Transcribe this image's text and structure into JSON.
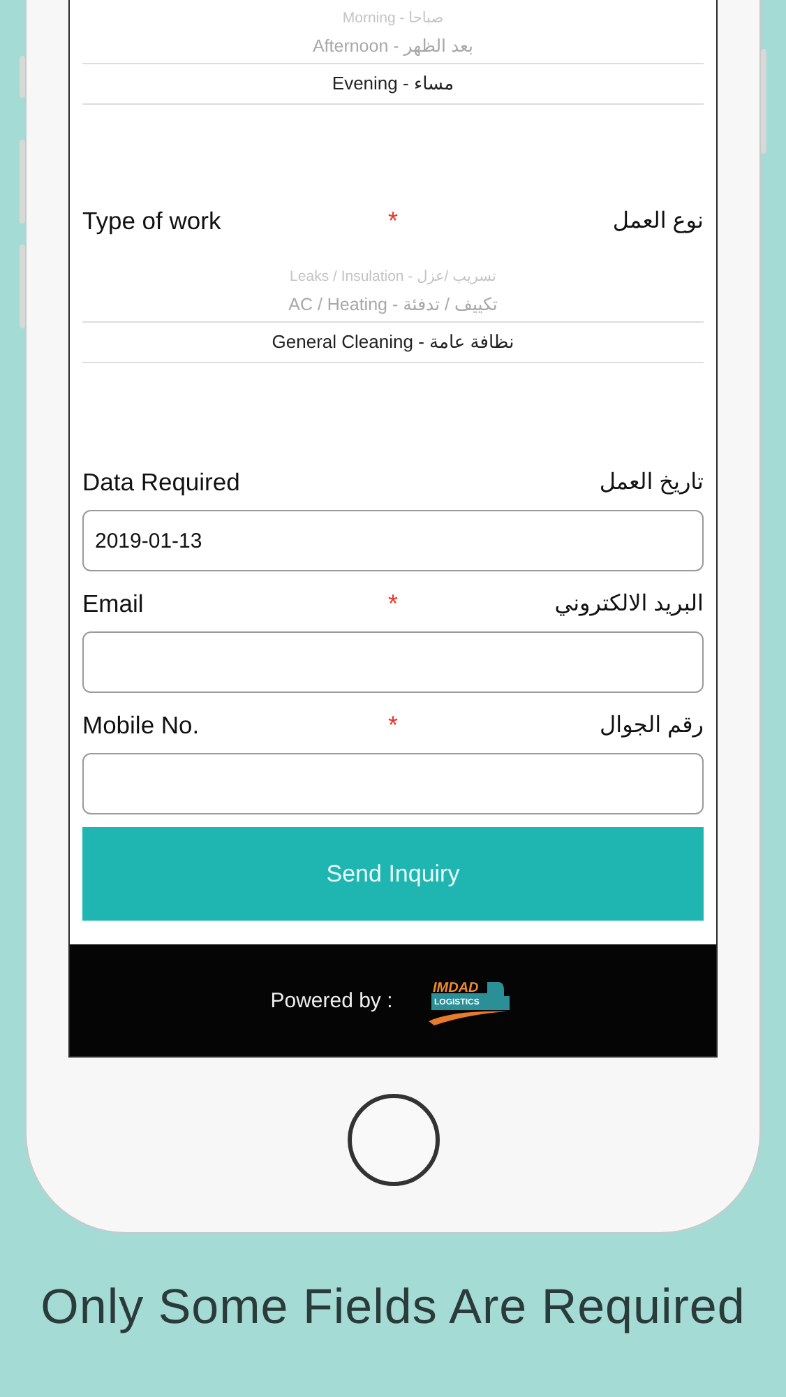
{
  "time_picker": {
    "options": [
      {
        "label": "Morning - صباحا",
        "selected": false
      },
      {
        "label": "Afternoon - بعد الظهر",
        "selected": false
      },
      {
        "label": "Evening - مساء",
        "selected": true
      }
    ]
  },
  "type_of_work": {
    "label_en": "Type of work",
    "required_mark": "*",
    "label_ar": "نوع العمل"
  },
  "work_picker": {
    "options": [
      {
        "label": "Leaks / Insulation - تسريب /عزل",
        "selected": false
      },
      {
        "label": "AC / Heating - تكييف / تدفئة",
        "selected": false
      },
      {
        "label": "General Cleaning - نظافة عامة",
        "selected": true
      }
    ]
  },
  "fields": [
    {
      "label_en": "Data Required",
      "label_ar": "تاريخ العمل",
      "value": "2019-01-13"
    },
    {
      "label_en": "Email",
      "required_mark": "*",
      "label_ar": "البريد الالكتروني"
    },
    {
      "label_en": "Mobile No.",
      "required_mark": "*",
      "label_ar": "رقم الجوال"
    }
  ],
  "submit_button": "Send Inquiry",
  "footer": {
    "text": "Powered by :",
    "logo_top": "IMDAD",
    "logo_bottom": "LOGISTICS"
  },
  "caption": "Only Some Fields Are Required"
}
